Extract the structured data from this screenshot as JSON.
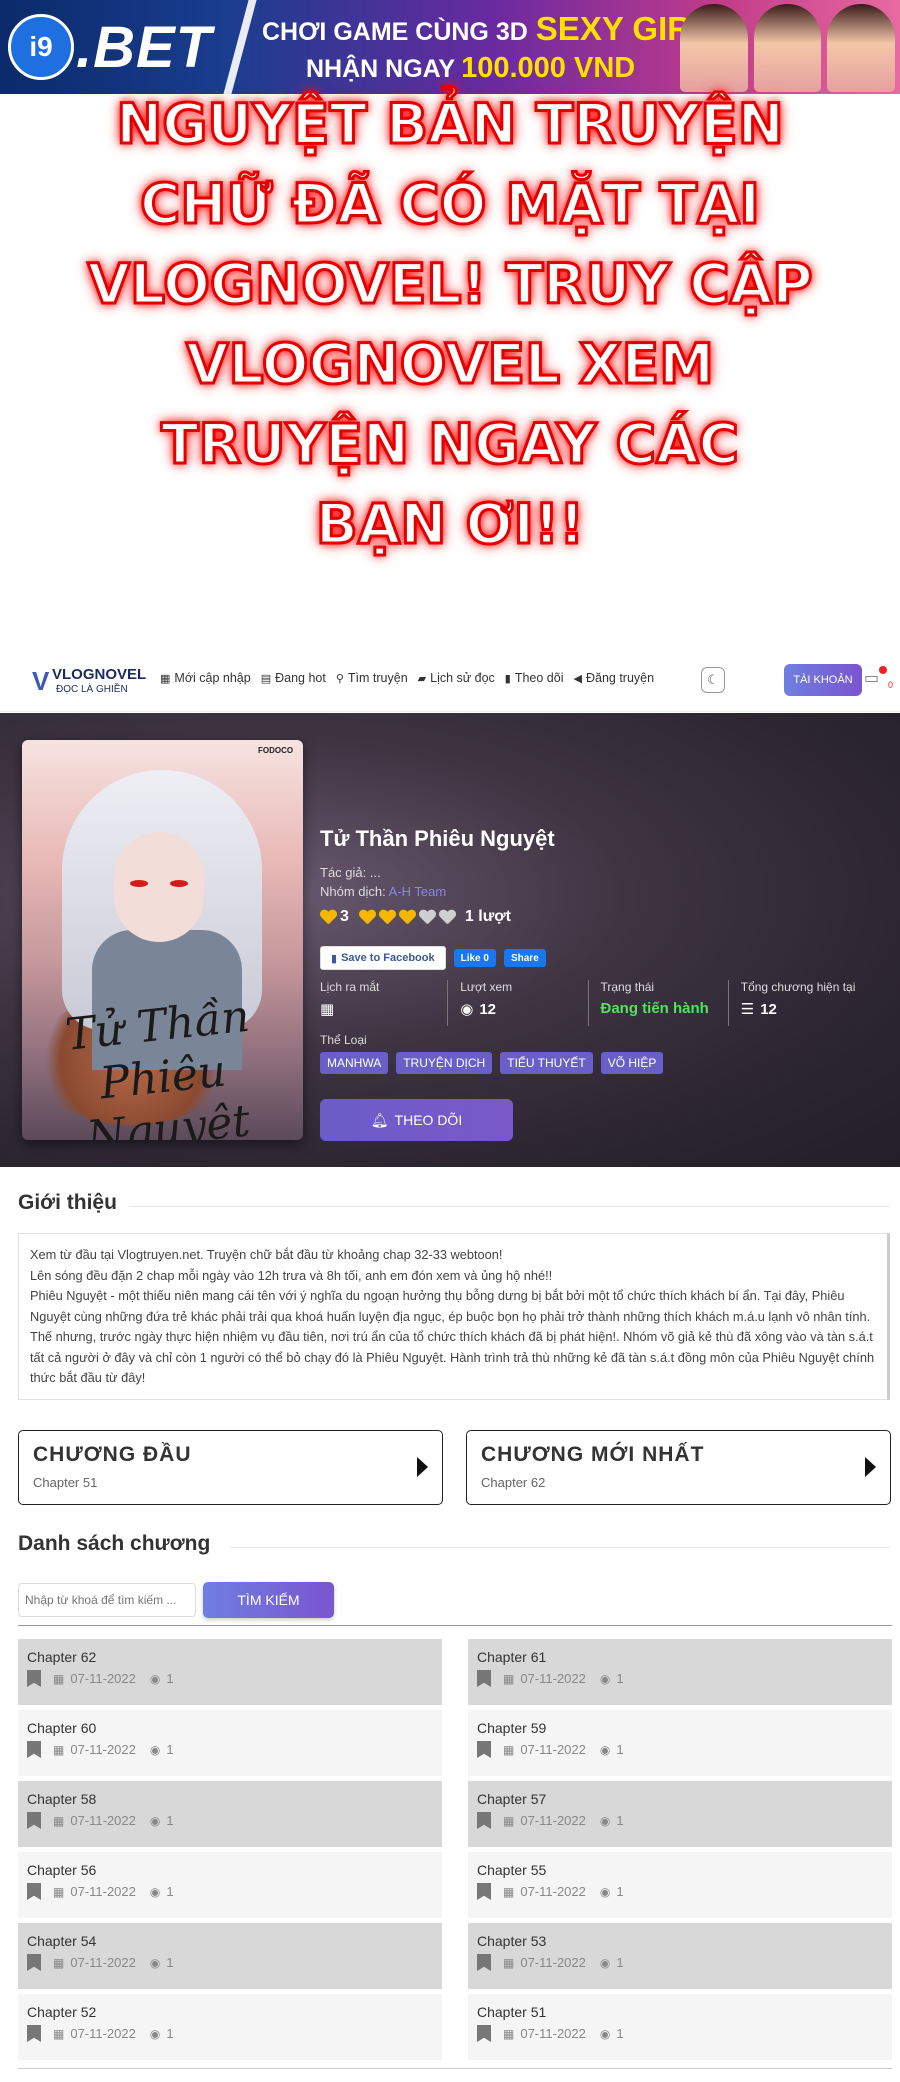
{
  "banner": {
    "logo_badge": "i9",
    "logo_text": ".BET",
    "line1": "CHƠI GAME CÙNG 3D",
    "line1_highlight": "SEXY GIRL",
    "line2": "NHẬN NGAY",
    "line2_highlight": "100.000 VND"
  },
  "notice": {
    "lines": [
      "NGUYỆT BẢN TRUYỆN",
      "CHỮ ĐÃ CÓ MẶT TẠI",
      "VLOGNOVEL! TRUY CẬP",
      "VLOGNOVEL XEM",
      "TRUYỆN NGAY CÁC",
      "BẠN ƠI!!"
    ]
  },
  "nav": {
    "logo_name": "VLOGNOVEL",
    "logo_sub": "ĐỌC LÀ GHIỀN",
    "items": [
      {
        "label": "Mới cập nhập",
        "icon": "grid-icon"
      },
      {
        "label": "Đang hot",
        "icon": "hot-icon"
      },
      {
        "label": "Tìm truyện",
        "icon": "search-icon"
      },
      {
        "label": "Lịch sử đọc",
        "icon": "book-icon"
      },
      {
        "label": "Theo dõi",
        "icon": "bookmark-icon"
      },
      {
        "label": "Đăng truyện",
        "icon": "megaphone-icon"
      }
    ],
    "account_label": "TÀI KHOẢN",
    "notify_count": "0"
  },
  "story": {
    "cover_title": "Tử Thần Phiêu Nguyệt",
    "cover_publisher": "FODOCO",
    "title": "Tử Thần Phiêu Nguyệt",
    "author_label": "Tác giả:",
    "author": "...",
    "translator_label": "Nhóm dịch:",
    "translator": "A-H Team",
    "rating_count_prefix": "3",
    "rating_value": 3,
    "rating_max": 5,
    "rating_votes": "1 lượt",
    "fb_save": "Save to Facebook",
    "fb_like": "Like 0",
    "fb_share": "Share",
    "stats": [
      {
        "label": "Lịch ra mắt",
        "value": "",
        "icon": "calendar-icon"
      },
      {
        "label": "Lượt xem",
        "value": "12",
        "icon": "eye-icon"
      },
      {
        "label": "Trạng thái",
        "value": "Đang tiến hành",
        "icon": ""
      },
      {
        "label": "Tổng chương hiện tại",
        "value": "12",
        "icon": "list-icon"
      }
    ],
    "genres_label": "Thể Loại",
    "genres": [
      "MANHWA",
      "TRUYỆN DỊCH",
      "TIỂU THUYẾT",
      "VÕ HIỆP"
    ],
    "follow_label": "THEO DÕI"
  },
  "intro": {
    "heading": "Giới thiệu",
    "lines": [
      "Xem từ đầu tại Vlogtruyen.net. Truyện chữ bắt đầu từ khoảng chap 32-33 webtoon!",
      "Lên sóng đều đặn 2 chap mỗi ngày vào 12h trưa và 8h tối, anh em đón xem và ủng hộ nhé!!",
      "Phiêu Nguyệt - một thiếu niên mang cái tên với ý nghĩa du ngoạn hưởng thụ bỗng dưng bị bắt bởi một tổ chức thích khách bí ẩn. Tại đây, Phiêu Nguyệt cùng những đứa trẻ khác phải trải qua khoá huấn luyện địa ngục, ép buộc bọn họ phải trở thành những thích khách m.á.u lạnh vô nhân tính. Thế nhưng, trước ngày thực hiện nhiệm vụ đầu tiên, nơi trú ẩn của tổ chức thích khách đã bị phát hiện!. Nhóm võ giả kẻ thù đã xông vào và tàn s.á.t tất cả người ở đây và chỉ còn 1 người có thể bỏ chạy đó là Phiêu Nguyệt. Hành trình trả thù những kẻ đã tàn s.á.t đồng môn của Phiêu Nguyệt chính thức bắt đầu từ đây!"
    ]
  },
  "first_chapter": {
    "label": "CHƯƠNG ĐẦU",
    "chapter": "Chapter 51"
  },
  "latest_chapter": {
    "label": "CHƯƠNG MỚI NHẤT",
    "chapter": "Chapter 62"
  },
  "chapter_list": {
    "heading": "Danh sách chương",
    "search_placeholder": "Nhập từ khoá để tìm kiếm ...",
    "search_button": "TÌM KIẾM",
    "items": [
      {
        "name": "Chapter 62",
        "date": "07-11-2022",
        "views": "1"
      },
      {
        "name": "Chapter 61",
        "date": "07-11-2022",
        "views": "1"
      },
      {
        "name": "Chapter 60",
        "date": "07-11-2022",
        "views": "1"
      },
      {
        "name": "Chapter 59",
        "date": "07-11-2022",
        "views": "1"
      },
      {
        "name": "Chapter 58",
        "date": "07-11-2022",
        "views": "1"
      },
      {
        "name": "Chapter 57",
        "date": "07-11-2022",
        "views": "1"
      },
      {
        "name": "Chapter 56",
        "date": "07-11-2022",
        "views": "1"
      },
      {
        "name": "Chapter 55",
        "date": "07-11-2022",
        "views": "1"
      },
      {
        "name": "Chapter 54",
        "date": "07-11-2022",
        "views": "1"
      },
      {
        "name": "Chapter 53",
        "date": "07-11-2022",
        "views": "1"
      },
      {
        "name": "Chapter 52",
        "date": "07-11-2022",
        "views": "1"
      },
      {
        "name": "Chapter 51",
        "date": "07-11-2022",
        "views": "1"
      }
    ]
  },
  "colors": {
    "accent": "#6a5fc8",
    "status_green": "#55e05f",
    "notice_red": "#e50000"
  }
}
